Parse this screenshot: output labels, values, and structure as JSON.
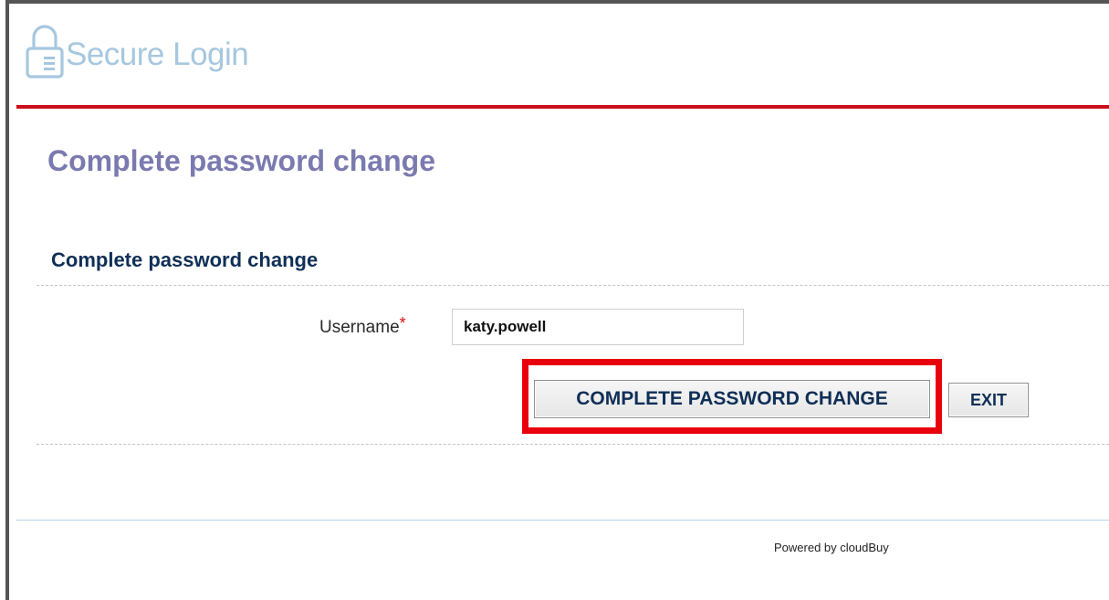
{
  "header": {
    "brand_text": "Secure Login",
    "lock_icon": "lock-icon",
    "accent_color": "#cc0e1c"
  },
  "page": {
    "title": "Complete password change"
  },
  "form": {
    "section_title": "Complete password change",
    "username_label": "Username",
    "required_marker": "*",
    "username_value": "katy.powell",
    "submit_label": "COMPLETE PASSWORD CHANGE",
    "exit_label": "EXIT",
    "highlight_color": "#e8000c"
  },
  "footer": {
    "powered_by": "Powered by cloudBuy"
  }
}
